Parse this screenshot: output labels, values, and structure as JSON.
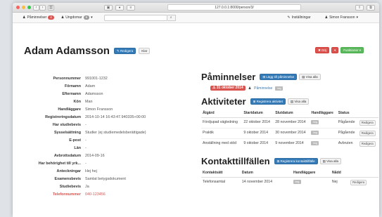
{
  "browser": {
    "url": "127.0.0.1:8000/person/3/",
    "sidebar_icon": "sidebar-icon",
    "share_icon": "share-icon"
  },
  "nav": {
    "reminders_label": "Påminnelser",
    "reminders_count": "4",
    "youth_label": "Ungdomar",
    "youth_count": "6",
    "search_placeholder": "",
    "settings_label": "Inställningar",
    "user_label": "Simon Fransson"
  },
  "person": {
    "name": "Adam Adamsson",
    "edit_label": "Redigera",
    "done_label": "Klar",
    "delete_label": "Döj",
    "functions_label": "Funktioner"
  },
  "details": [
    {
      "label": "Personnummer",
      "value": "991001-1232"
    },
    {
      "label": "Förnamn",
      "value": "Adam"
    },
    {
      "label": "Efternamn",
      "value": "Adamsson"
    },
    {
      "label": "Kön",
      "value": "Man"
    },
    {
      "label": "Handläggare",
      "value": "Simon Fransson"
    },
    {
      "label": "Registreringsdatum",
      "value": "2014-10-14 16:43:47.940335+00:00"
    },
    {
      "label": "Har studiebevis",
      "value": "-"
    },
    {
      "label": "Sysselsättning",
      "value": "Studier (ej studiemedelsberättigade)"
    },
    {
      "label": "E-post",
      "value": "-"
    },
    {
      "label": "Län",
      "value": "-"
    },
    {
      "label": "Avbrottsdatum",
      "value": "2014-09-16"
    },
    {
      "label": "Har behörighet till yrk...",
      "value": "-"
    },
    {
      "label": "Anteckningar",
      "value": "Hej hej"
    },
    {
      "label": "Examensbevis",
      "value": "Samlat betygsdokument"
    },
    {
      "label": "Studiebevis",
      "value": "Ja"
    },
    {
      "label": "Telefonnummer",
      "value": "040-123456"
    }
  ],
  "reminders": {
    "title": "Påminnelser",
    "add_label": "Lägg till påminnelse",
    "show_all_label": "Visa alla",
    "date": "31 oktober 2014",
    "item_label": "Påminnelse"
  },
  "activities": {
    "title": "Aktiviteter",
    "add_label": "Registrera aktivitet",
    "show_all_label": "Visa alla",
    "columns": [
      "Åtgärd",
      "Startdatum",
      "Slutdatum",
      "Handläggare",
      "Status"
    ],
    "rows": [
      {
        "action": "Fördjupad vägledning",
        "start": "22 oktober 2014",
        "end": "28 november 2014",
        "status": "Pågående",
        "edit": "Redigera"
      },
      {
        "action": "Praktik",
        "start": "9 oktober 2014",
        "end": "30 november 2014",
        "status": "Pågående",
        "edit": "Redigera"
      },
      {
        "action": "Anställning med stöd",
        "start": "9 oktober 2014",
        "end": "9 november 2014",
        "status": "Avbruten",
        "edit": "Redigera"
      }
    ]
  },
  "contacts": {
    "title": "Kontakttillfällen",
    "add_label": "Registrera kontakttillfälle",
    "show_all_label": "Visa alla",
    "columns": [
      "Kontaktsätt",
      "Datum",
      "Handläggare",
      "Nådd"
    ],
    "rows": [
      {
        "method": "Telefonsamtal",
        "date": "14 november 2014",
        "reached": "Nej",
        "edit": "Redigera"
      }
    ]
  }
}
